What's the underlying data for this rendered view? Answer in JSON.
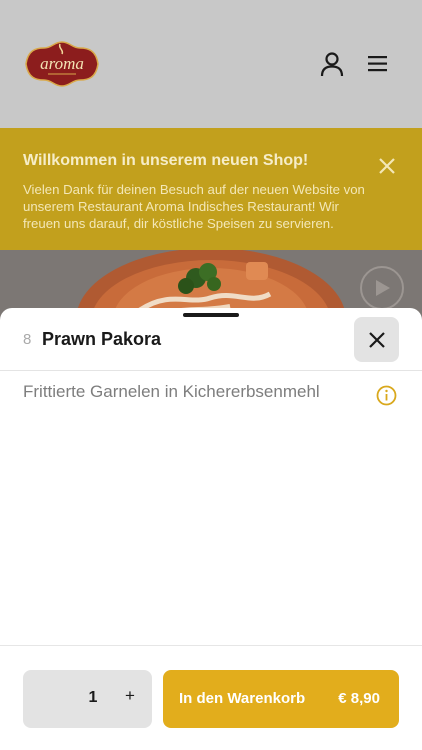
{
  "header": {
    "logo_text": "aroma",
    "icons": {
      "user": "user-icon",
      "menu": "hamburger-menu-icon"
    }
  },
  "banner": {
    "title": "Willkommen in unserem neuen Shop!",
    "text": "Vielen Dank für deinen Besuch auf der neuen Website von unserem Restaurant Aroma Indisches Restaurant! Wir freuen uns darauf, dir köstliche Speisen zu servieren.",
    "close_icon": "close-icon"
  },
  "item": {
    "number": "8",
    "title": "Prawn Pakora",
    "description": "Frittierte Garnelen in Kichererbsenmehl"
  },
  "footer": {
    "quantity": "1",
    "plus": "+",
    "add_to_cart": "In den Warenkorb",
    "price": "€ 8,90"
  },
  "colors": {
    "header_bg": "#c8c8c8",
    "banner_bg": "#c2a01d",
    "accent": "#e2ad1c",
    "button_grey": "#e3e3e3"
  }
}
